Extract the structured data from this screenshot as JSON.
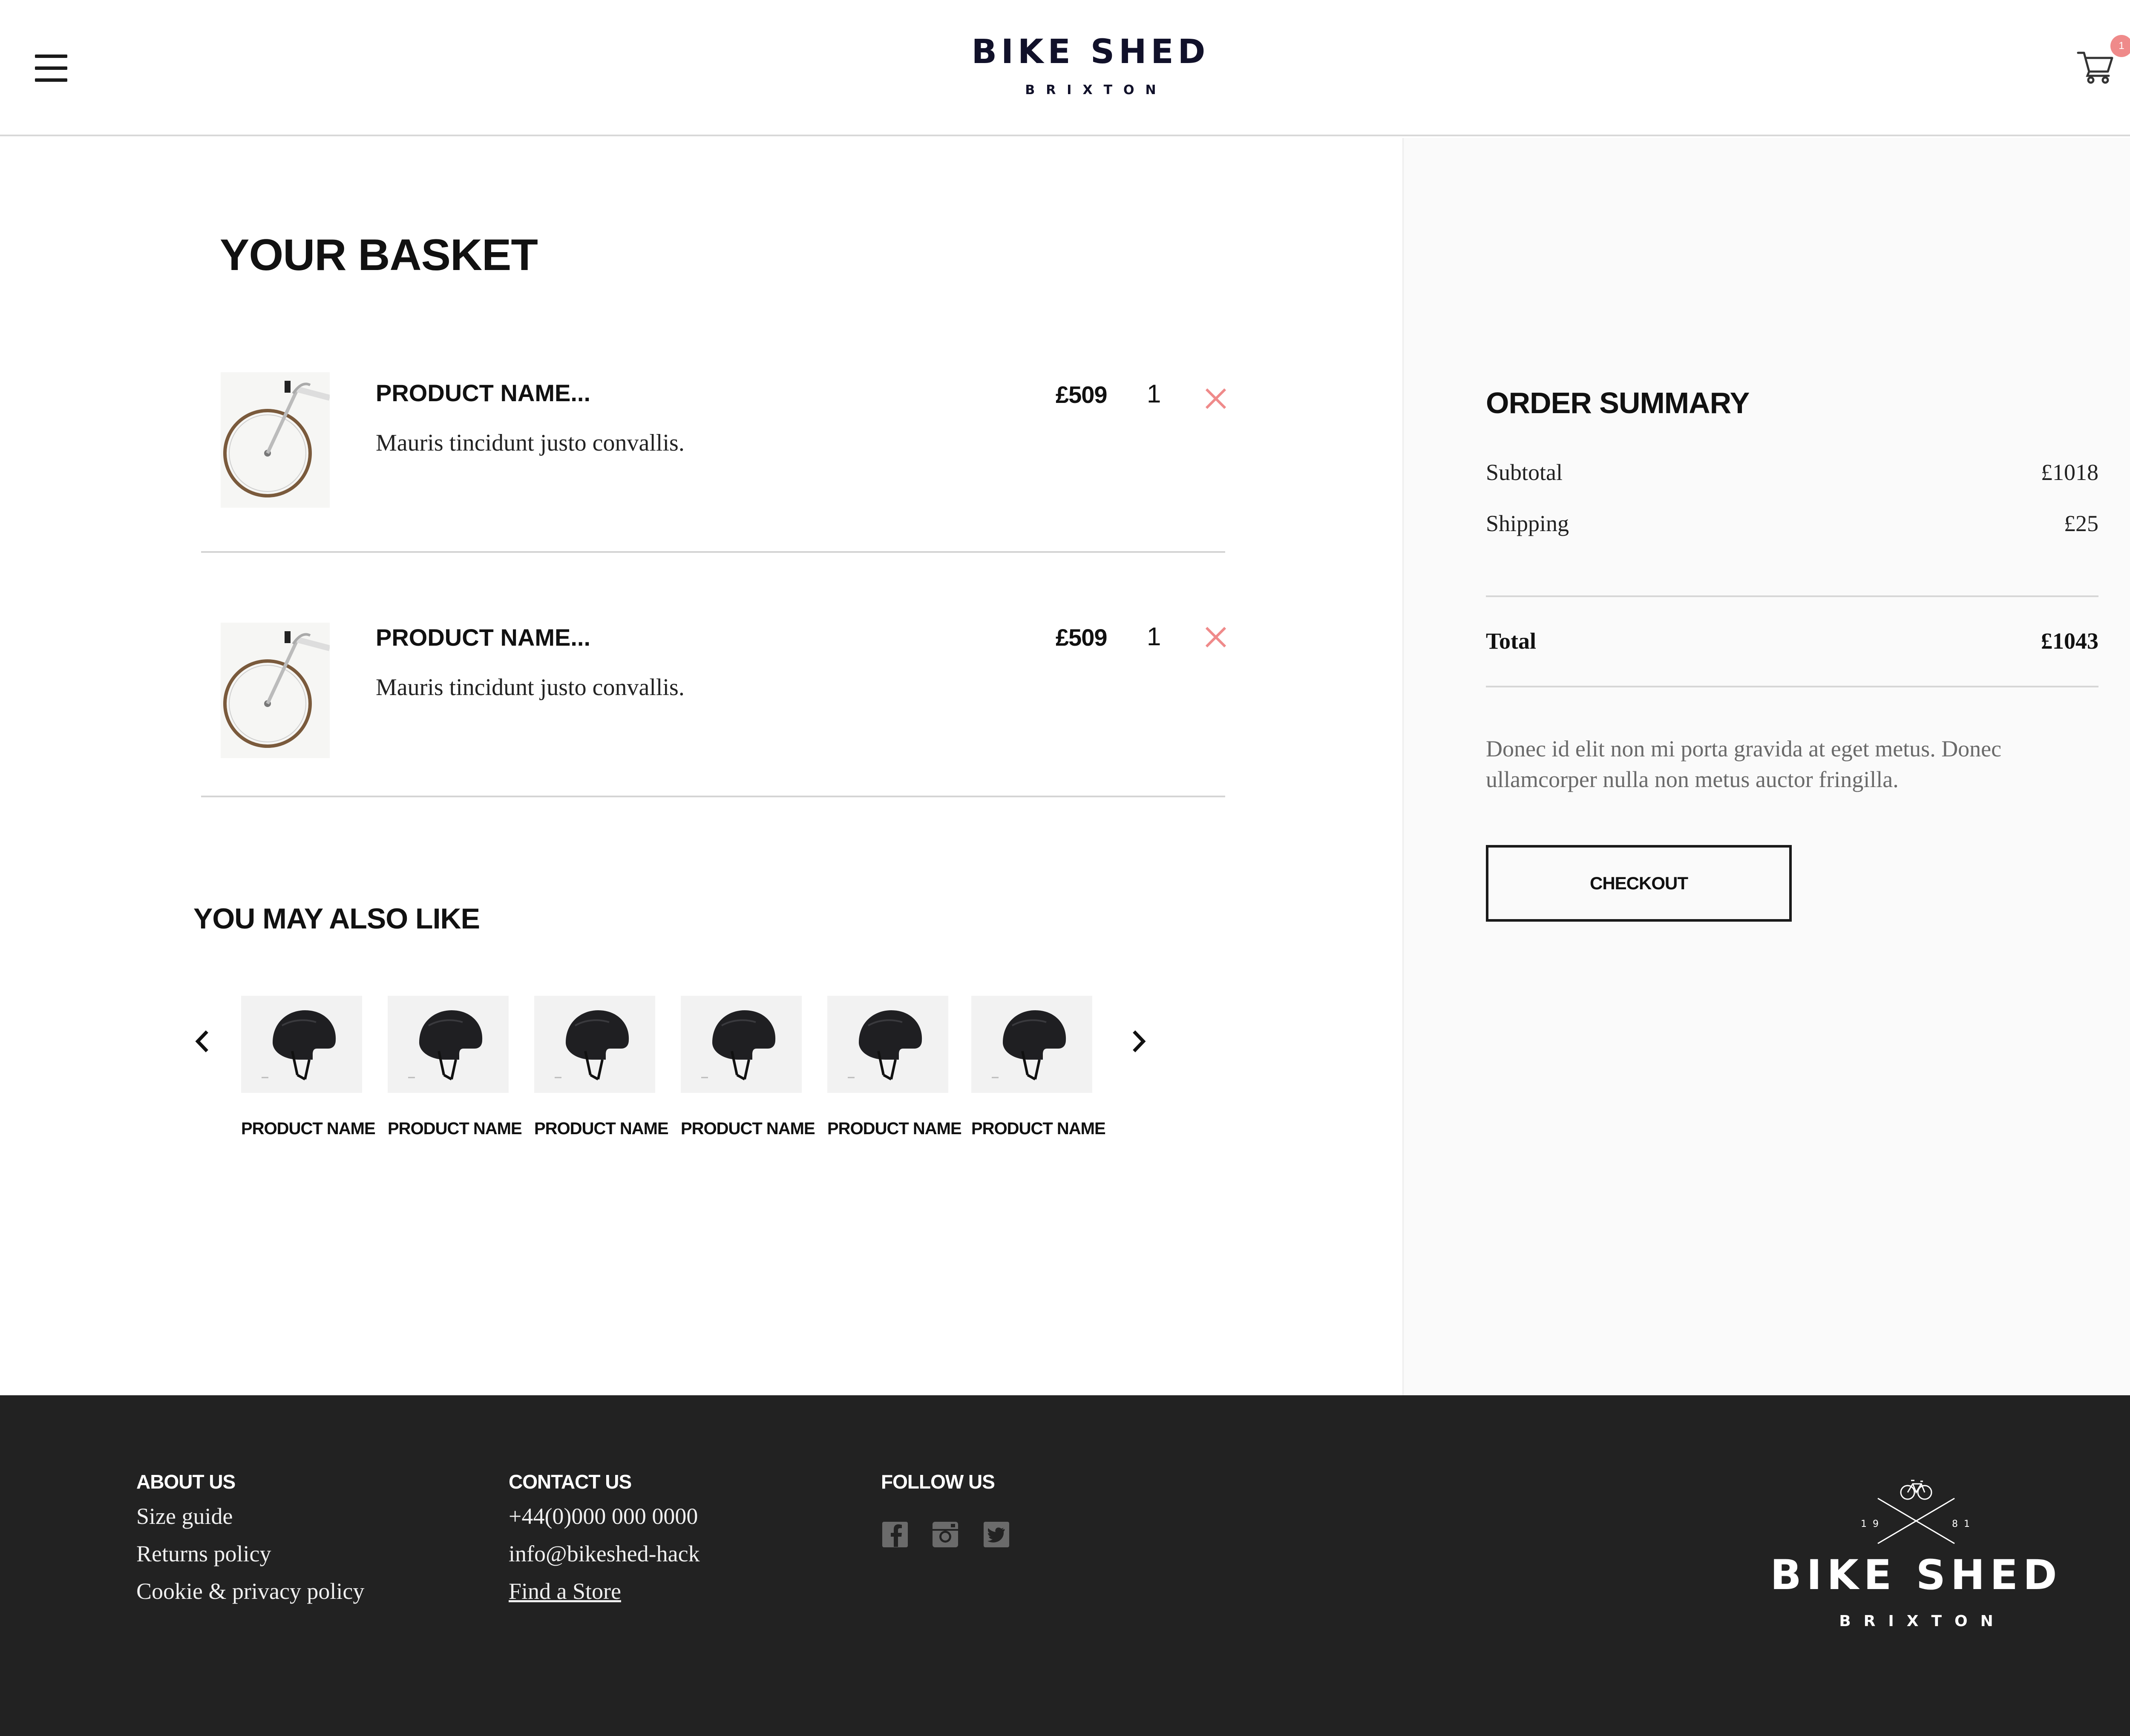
{
  "header": {
    "brand_name": "BIKE SHED",
    "brand_sub": "BRIXTON",
    "cart_count": "1"
  },
  "basket": {
    "title": "YOUR BASKET",
    "items": [
      {
        "name": "PRODUCT NAME...",
        "desc": "Mauris tincidunt justo convallis.",
        "price": "£509",
        "qty": "1"
      },
      {
        "name": "PRODUCT NAME...",
        "desc": "Mauris tincidunt justo convallis.",
        "price": "£509",
        "qty": "1"
      }
    ]
  },
  "recommendations": {
    "title": "YOU MAY ALSO LIKE",
    "items": [
      {
        "name": "PRODUCT NAME"
      },
      {
        "name": "PRODUCT NAME"
      },
      {
        "name": "PRODUCT NAME"
      },
      {
        "name": "PRODUCT NAME"
      },
      {
        "name": "PRODUCT NAME"
      },
      {
        "name": "PRODUCT NAME"
      }
    ]
  },
  "summary": {
    "title": "ORDER SUMMARY",
    "subtotal_label": "Subtotal",
    "subtotal_value": "£1018",
    "shipping_label": "Shipping",
    "shipping_value": "£25",
    "total_label": "Total",
    "total_value": "£1043",
    "note": "Donec id elit non mi porta gravida at eget metus. Donec ullamcorper nulla non metus auctor fringilla.",
    "checkout_label": "CHECKOUT"
  },
  "footer": {
    "about": {
      "heading": "ABOUT US",
      "links": [
        "Size guide",
        "Returns policy",
        "Cookie & privacy policy"
      ]
    },
    "contact": {
      "heading": "CONTACT US",
      "phone": "+44(0)000 000 0000",
      "email": "info@bikeshed-hack",
      "store_link": "Find a Store"
    },
    "follow": {
      "heading": "FOLLOW US",
      "icons": [
        "facebook-icon",
        "instagram-icon",
        "twitter-icon"
      ]
    },
    "logo": {
      "name": "BIKE SHED",
      "sub": "BRIXTON",
      "year_left": "19",
      "year_right": "81"
    }
  },
  "colors": {
    "accent_remove": "#ef8a8a",
    "footer_bg": "#222222",
    "summary_bg": "#fafafa",
    "text_dark": "#11112a"
  }
}
